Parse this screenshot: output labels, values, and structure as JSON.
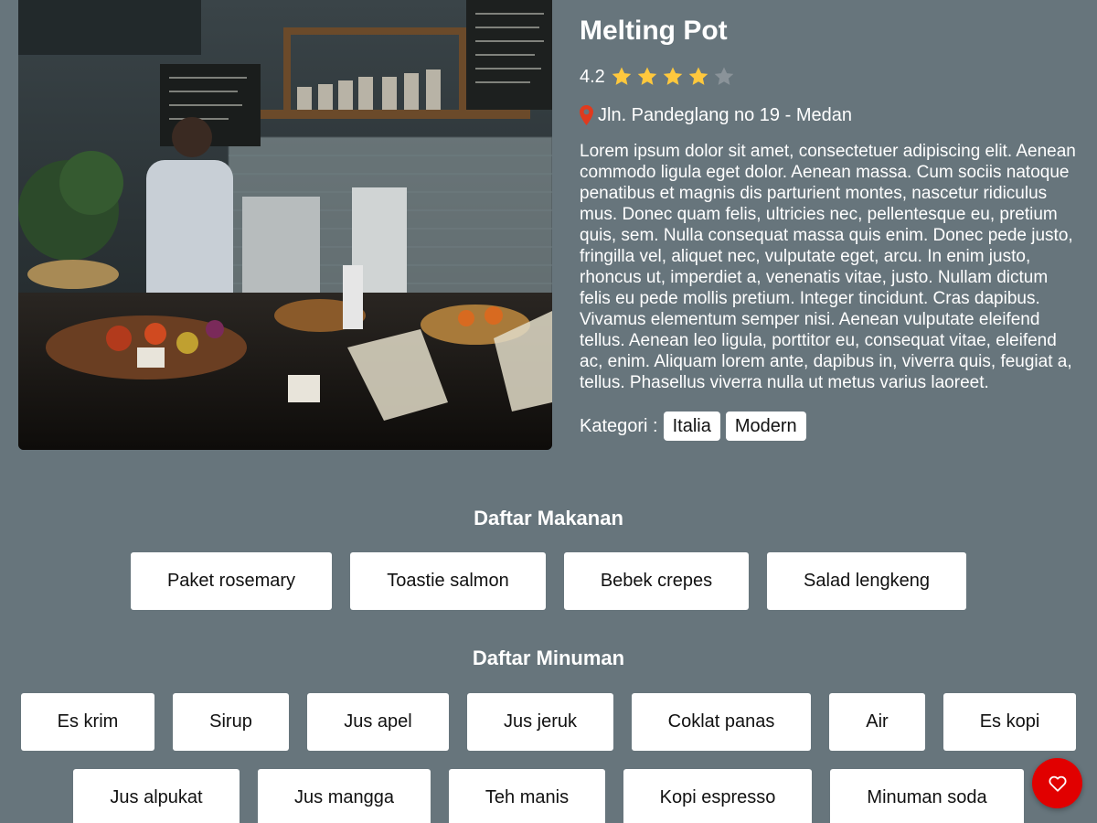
{
  "restaurant": {
    "name": "Melting Pot",
    "rating": "4.2",
    "rating_value": 4.2,
    "rating_max": 5,
    "address": "Jln. Pandeglang no 19 - Medan",
    "description": "Lorem ipsum dolor sit amet, consectetuer adipiscing elit. Aenean commodo ligula eget dolor. Aenean massa. Cum sociis natoque penatibus et magnis dis parturient montes, nascetur ridiculus mus. Donec quam felis, ultricies nec, pellentesque eu, pretium quis, sem. Nulla consequat massa quis enim. Donec pede justo, fringilla vel, aliquet nec, vulputate eget, arcu. In enim justo, rhoncus ut, imperdiet a, venenatis vitae, justo. Nullam dictum felis eu pede mollis pretium. Integer tincidunt. Cras dapibus. Vivamus elementum semper nisi. Aenean vulputate eleifend tellus. Aenean leo ligula, porttitor eu, consequat vitae, eleifend ac, enim. Aliquam lorem ante, dapibus in, viverra quis, feugiat a, tellus. Phasellus viverra nulla ut metus varius laoreet.",
    "category_label": "Kategori :",
    "categories": [
      "Italia",
      "Modern"
    ]
  },
  "foods": {
    "title": "Daftar Makanan",
    "items": [
      "Paket rosemary",
      "Toastie salmon",
      "Bebek crepes",
      "Salad lengkeng"
    ]
  },
  "drinks": {
    "title": "Daftar Minuman",
    "row1": [
      "Es krim",
      "Sirup",
      "Jus apel",
      "Jus jeruk",
      "Coklat panas",
      "Air",
      "Es kopi"
    ],
    "row2": [
      "Jus alpukat",
      "Jus mangga",
      "Teh manis",
      "Kopi espresso",
      "Minuman soda"
    ]
  },
  "colors": {
    "background": "#67757c",
    "star_filled": "#ffc83d",
    "star_empty": "#8a9399",
    "pin": "#e03a1e",
    "fab": "#e10000"
  },
  "icons": {
    "star": "star-icon",
    "pin": "map-pin-icon",
    "favorite": "heart-icon"
  }
}
